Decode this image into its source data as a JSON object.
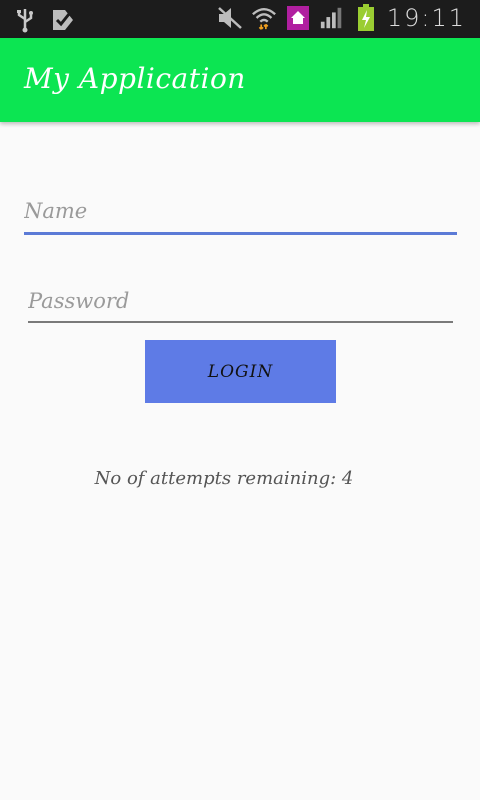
{
  "status_bar": {
    "time": "19:11",
    "left_icons": [
      "usb-icon",
      "download-check-icon"
    ],
    "right_icons": [
      "mute-icon",
      "wifi-icon",
      "home-icon",
      "signal-icon",
      "battery-charging-icon"
    ]
  },
  "app_bar": {
    "title": "My Application",
    "color": "#0ce552"
  },
  "form": {
    "name_placeholder": "Name",
    "password_placeholder": "Password",
    "login_label": "LOGIN",
    "login_color": "#5e7be6"
  },
  "attempts_text": "No of attempts remaining: 4"
}
